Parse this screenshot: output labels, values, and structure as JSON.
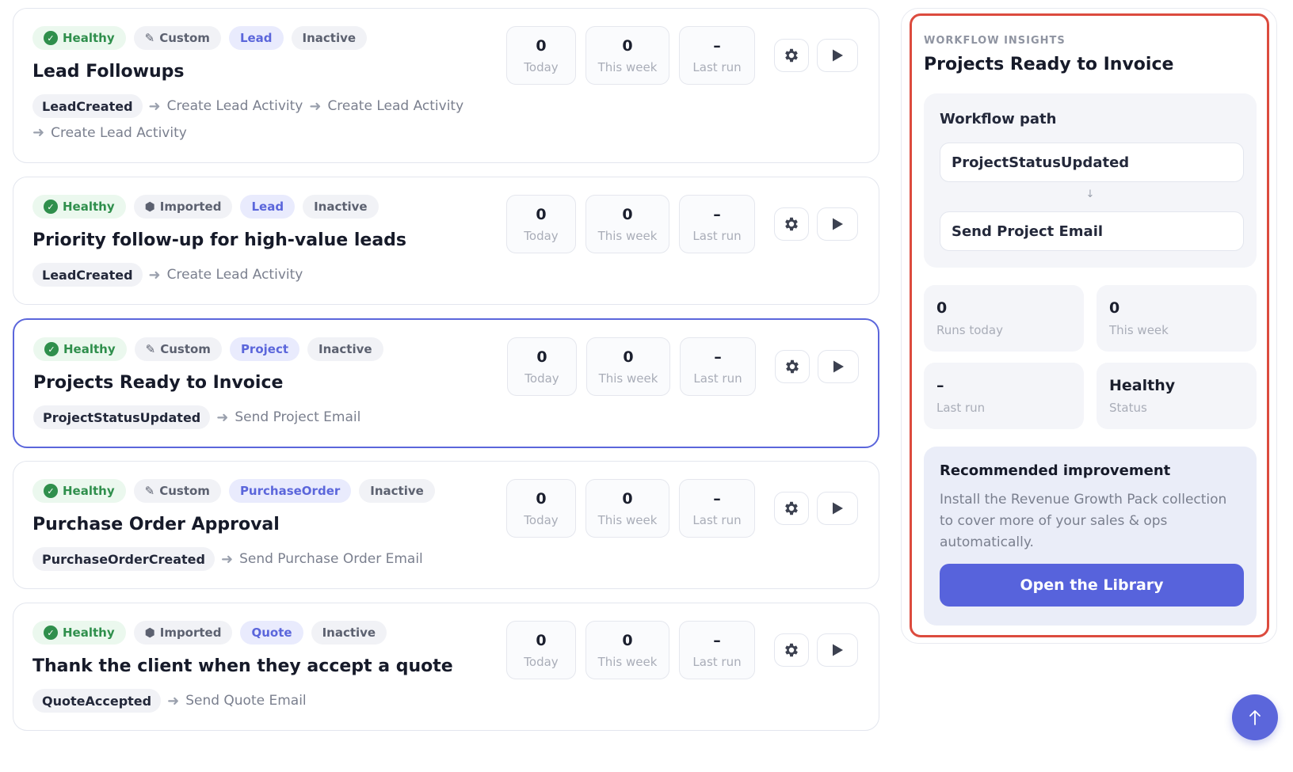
{
  "workflows": [
    {
      "status": "Healthy",
      "source": "Custom",
      "source_icon": "pencil-icon",
      "entity": "Lead",
      "state": "Inactive",
      "title": "Lead Followups",
      "trigger": "LeadCreated",
      "steps": [
        "Create Lead Activity",
        "Create Lead Activity",
        "Create Lead Activity"
      ],
      "stats": {
        "today": "0",
        "week": "0",
        "last_run": "–"
      }
    },
    {
      "status": "Healthy",
      "source": "Imported",
      "source_icon": "box-icon",
      "entity": "Lead",
      "state": "Inactive",
      "title": "Priority follow-up for high-value leads",
      "trigger": "LeadCreated",
      "steps": [
        "Create Lead Activity"
      ],
      "stats": {
        "today": "0",
        "week": "0",
        "last_run": "–"
      }
    },
    {
      "status": "Healthy",
      "source": "Custom",
      "source_icon": "pencil-icon",
      "entity": "Project",
      "state": "Inactive",
      "title": "Projects Ready to Invoice",
      "trigger": "ProjectStatusUpdated",
      "steps": [
        "Send Project Email"
      ],
      "stats": {
        "today": "0",
        "week": "0",
        "last_run": "–"
      }
    },
    {
      "status": "Healthy",
      "source": "Custom",
      "source_icon": "pencil-icon",
      "entity": "PurchaseOrder",
      "state": "Inactive",
      "title": "Purchase Order Approval",
      "trigger": "PurchaseOrderCreated",
      "steps": [
        "Send Purchase Order Email"
      ],
      "stats": {
        "today": "0",
        "week": "0",
        "last_run": "–"
      }
    },
    {
      "status": "Healthy",
      "source": "Imported",
      "source_icon": "box-icon",
      "entity": "Quote",
      "state": "Inactive",
      "title": "Thank the client when they accept a quote",
      "trigger": "QuoteAccepted",
      "steps": [
        "Send Quote Email"
      ],
      "stats": {
        "today": "0",
        "week": "0",
        "last_run": "–"
      }
    }
  ],
  "stat_labels": {
    "today": "Today",
    "week": "This week",
    "last_run": "Last run"
  },
  "insights": {
    "eyebrow": "WORKFLOW INSIGHTS",
    "title": "Projects Ready to Invoice",
    "path_label": "Workflow path",
    "path_trigger": "ProjectStatusUpdated",
    "path_arrow": "↓",
    "path_action": "Send Project Email",
    "runs_today_value": "0",
    "runs_today_label": "Runs today",
    "this_week_value": "0",
    "this_week_label": "This week",
    "last_run_value": "–",
    "last_run_label": "Last run",
    "status_value": "Healthy",
    "status_label": "Status",
    "rec_title": "Recommended improvement",
    "rec_text": "Install the Revenue Growth Pack collection to cover more of your sales & ops automatically.",
    "rec_button": "Open the Library"
  },
  "colors": {
    "accent": "#5b66db",
    "healthy": "#2f8f4c",
    "highlight_border": "#dc4b3e"
  }
}
